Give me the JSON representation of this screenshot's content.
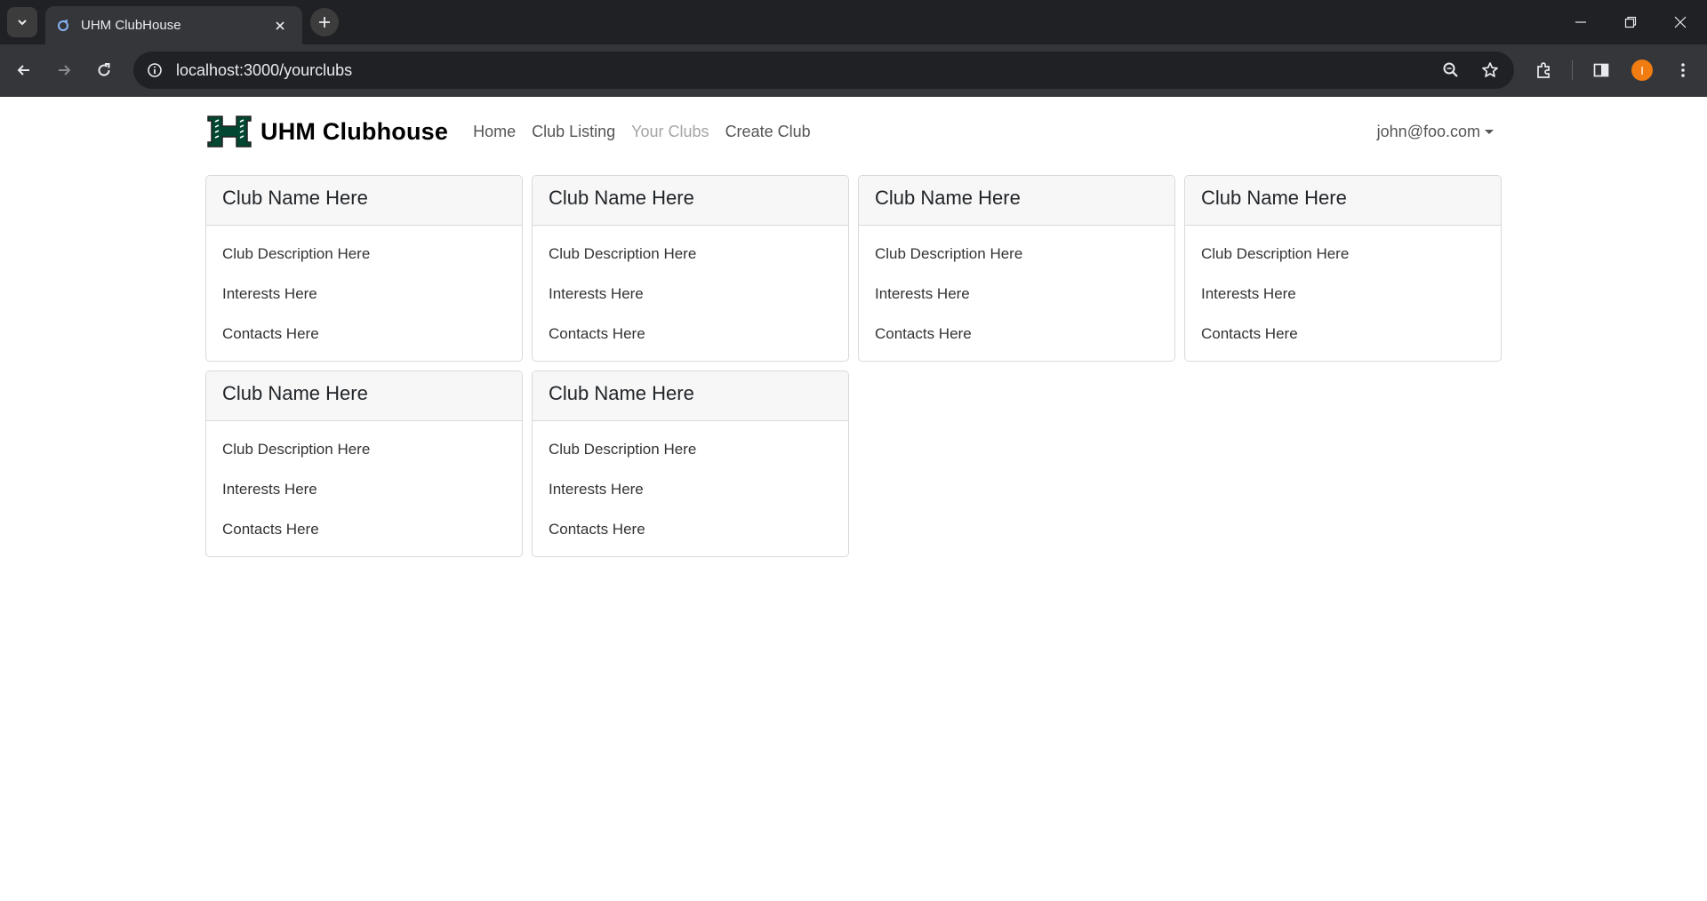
{
  "browser": {
    "tab_title": "UHM ClubHouse",
    "url": "localhost:3000/yourclubs",
    "profile_initial": "I",
    "icons": [
      "tab-list-icon",
      "favicon-icon",
      "close-icon",
      "plus-icon",
      "minimize-icon",
      "restore-icon",
      "close-window-icon",
      "back-icon",
      "forward-icon",
      "reload-icon",
      "info-icon",
      "zoom-icon",
      "star-icon",
      "extensions-icon",
      "sidepanel-icon",
      "menu-icon"
    ]
  },
  "navbar": {
    "brand": "UHM Clubhouse",
    "links": [
      {
        "label": "Home",
        "active": false
      },
      {
        "label": "Club Listing",
        "active": false
      },
      {
        "label": "Your Clubs",
        "active": true
      },
      {
        "label": "Create Club",
        "active": false
      }
    ],
    "user": "john@foo.com"
  },
  "cards": [
    {
      "name": "Club Name Here",
      "description": "Club Description Here",
      "interests": "Interests Here",
      "contacts": "Contacts Here"
    },
    {
      "name": "Club Name Here",
      "description": "Club Description Here",
      "interests": "Interests Here",
      "contacts": "Contacts Here"
    },
    {
      "name": "Club Name Here",
      "description": "Club Description Here",
      "interests": "Interests Here",
      "contacts": "Contacts Here"
    },
    {
      "name": "Club Name Here",
      "description": "Club Description Here",
      "interests": "Interests Here",
      "contacts": "Contacts Here"
    },
    {
      "name": "Club Name Here",
      "description": "Club Description Here",
      "interests": "Interests Here",
      "contacts": "Contacts Here"
    },
    {
      "name": "Club Name Here",
      "description": "Club Description Here",
      "interests": "Interests Here",
      "contacts": "Contacts Here"
    }
  ],
  "colors": {
    "accent": "#f07c12",
    "brand_green": "#024731"
  }
}
